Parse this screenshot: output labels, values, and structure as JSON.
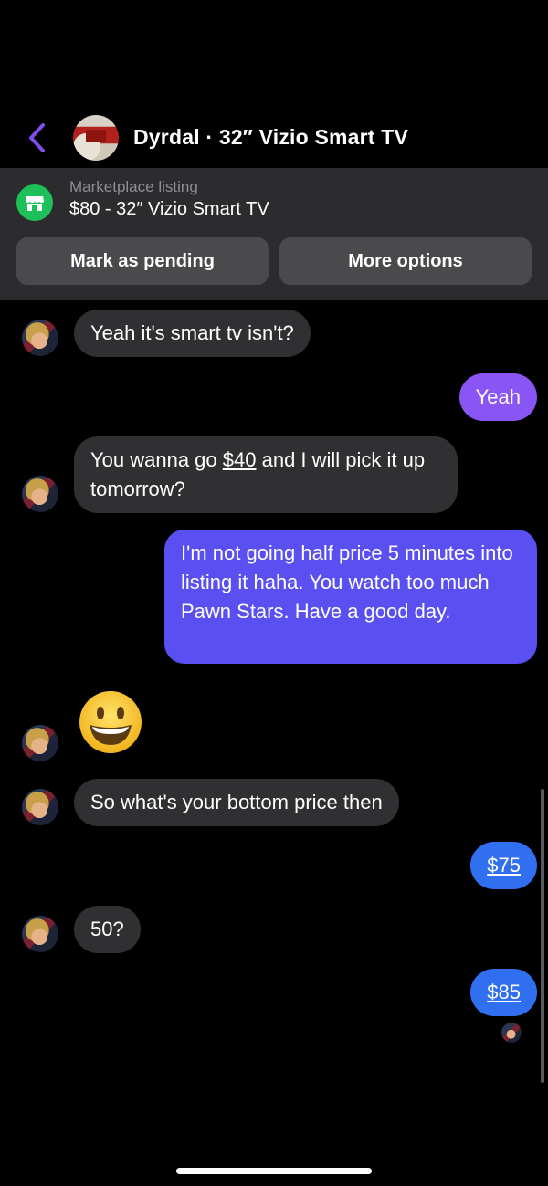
{
  "header": {
    "title": "Dyrdal · 32″ Vizio Smart TV",
    "accent_color": "#7b4fe8"
  },
  "listing": {
    "label": "Marketplace listing",
    "title": "$80 - 32″ Vizio Smart TV",
    "pending_button": "Mark as pending",
    "more_button": "More options",
    "icon": "storefront-icon"
  },
  "messages": {
    "m1": "Yeah it's smart tv isn't?",
    "m2": "Yeah",
    "m3_prefix": "You wanna go ",
    "m3_link": "$40",
    "m3_suffix": " and I will pick it up tomorrow?",
    "m4": "I'm not going half price 5 minutes into listing it haha. You watch too much Pawn Stars. Have a good day.",
    "m5_emoji": "grinning-face-emoji",
    "m6": "So what's your bottom price then",
    "m7": "$75",
    "m8": "50?",
    "m9": "$85"
  },
  "colors": {
    "incoming_bubble": "#303033",
    "outgoing_top": "#8a55f5",
    "outgoing_mid": "#5a4ff0",
    "outgoing_bottom": "#2f6ff0",
    "marketplace_green": "#1ec05a"
  }
}
